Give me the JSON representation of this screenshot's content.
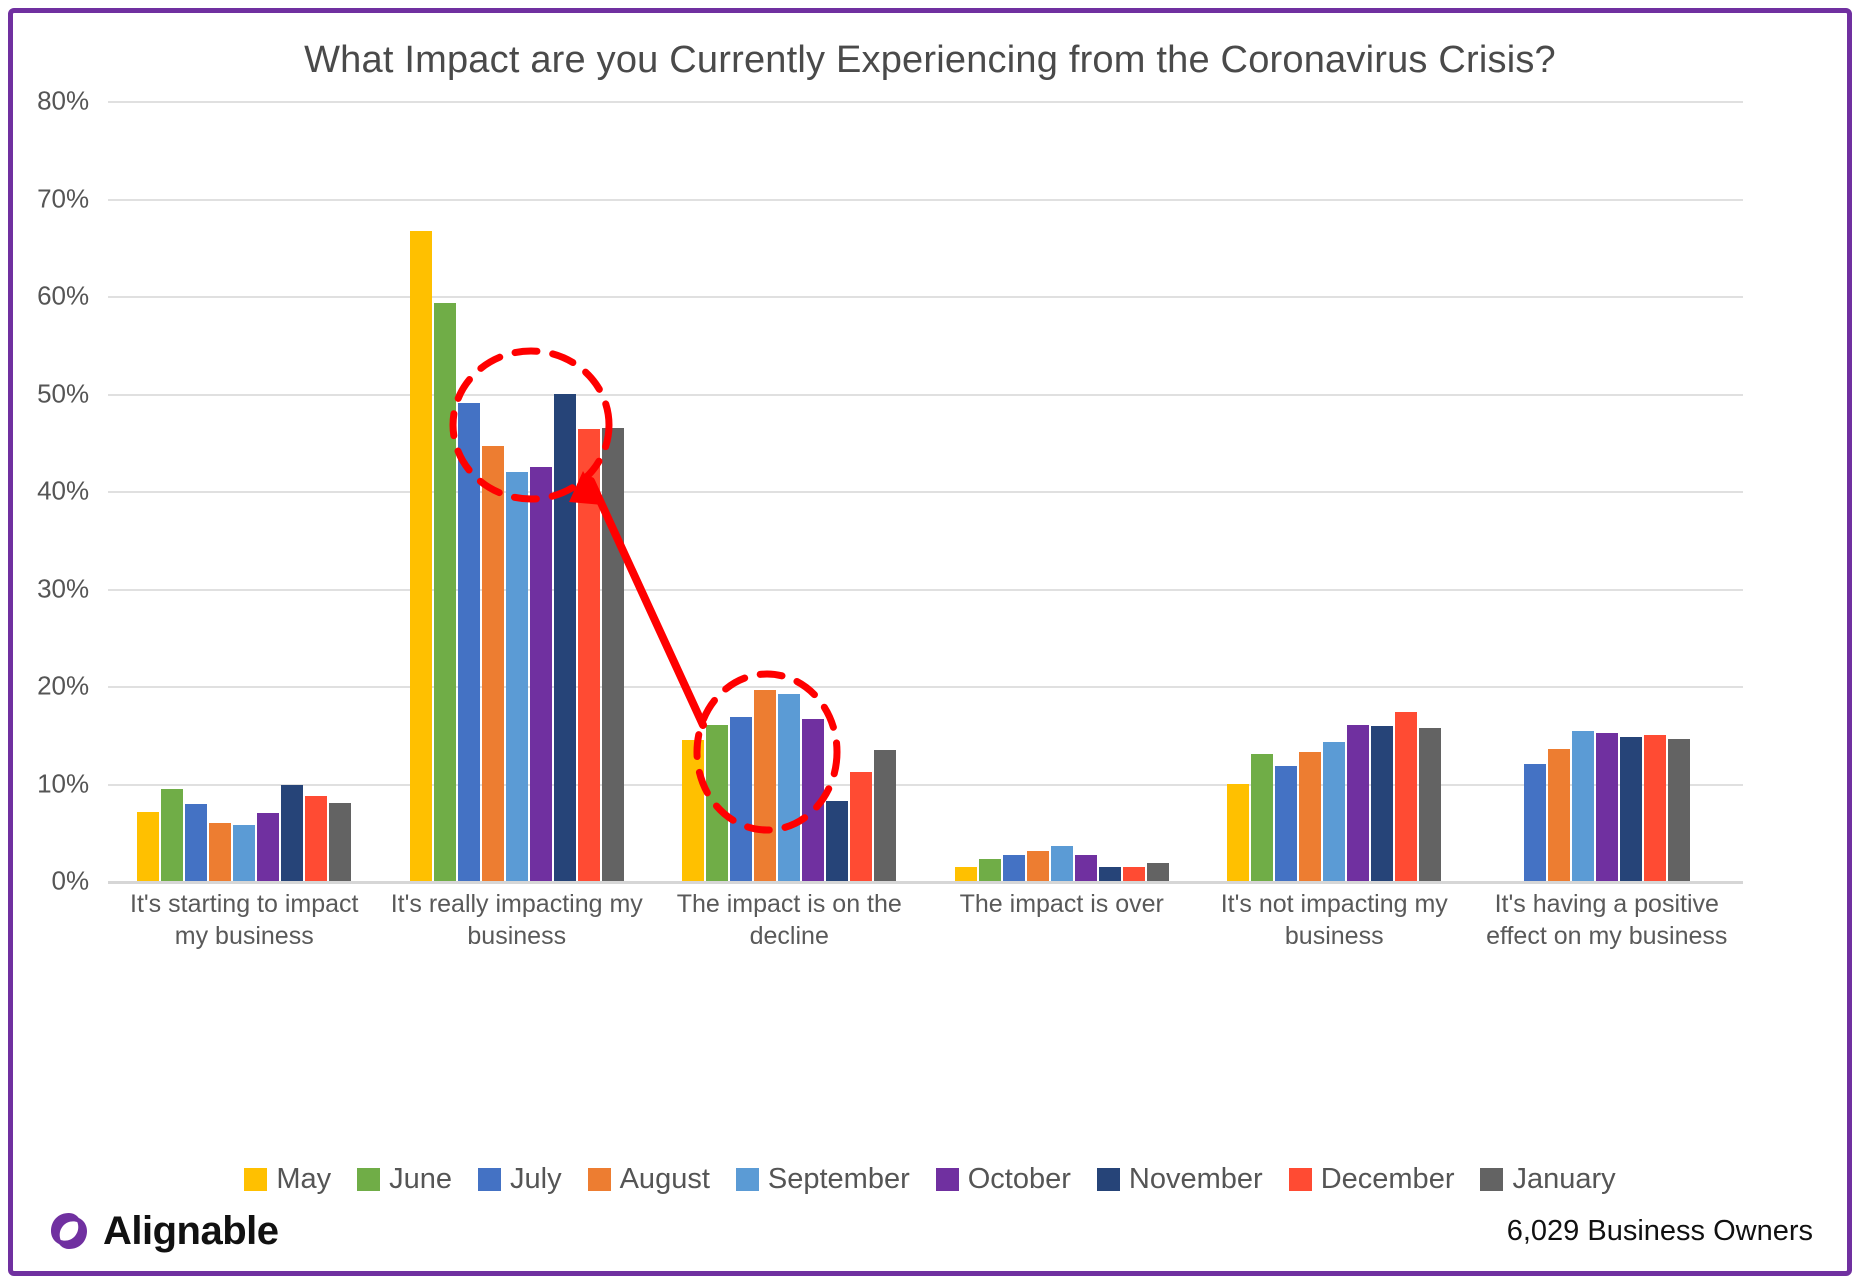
{
  "title": "What Impact are you Currently Experiencing from the Coronavirus Crisis?",
  "footer": {
    "brand": "Alignable",
    "respondents": "6,029 Business Owners"
  },
  "theme": {
    "border": "#7030A0",
    "annotation": "#FF0000",
    "grid": "#E0E0E0",
    "text": "#555555"
  },
  "legend": [
    {
      "label": "May",
      "color": "#FFC000"
    },
    {
      "label": "June",
      "color": "#70AD47"
    },
    {
      "label": "July",
      "color": "#4472C4"
    },
    {
      "label": "August",
      "color": "#ED7D31"
    },
    {
      "label": "September",
      "color": "#5B9BD5"
    },
    {
      "label": "October",
      "color": "#7030A0"
    },
    {
      "label": "November",
      "color": "#264478"
    },
    {
      "label": "December",
      "color": "#FF4B33"
    },
    {
      "label": "January",
      "color": "#636363"
    }
  ],
  "chart_data": {
    "type": "bar",
    "title": "What Impact are you Currently Experiencing from the Coronavirus Crisis?",
    "xlabel": "",
    "ylabel": "",
    "ylim": [
      0,
      80
    ],
    "ytick_labels": [
      "80%",
      "70%",
      "60%",
      "50%",
      "40%",
      "30%",
      "20%",
      "10%",
      "0%"
    ],
    "ytick_values": [
      80,
      70,
      60,
      50,
      40,
      30,
      20,
      10,
      0
    ],
    "grid": true,
    "legend_position": "bottom",
    "units": "percent",
    "categories": [
      "It's starting to impact my business",
      "It's really impacting my business",
      "The impact is on the decline",
      "The impact is over",
      "It's not impacting my business",
      "It's having a positive effect on my business"
    ],
    "series": [
      {
        "name": "May",
        "color": "#FFC000",
        "values": [
          7.1,
          66.7,
          14.5,
          1.4,
          10.0,
          null
        ]
      },
      {
        "name": "June",
        "color": "#70AD47",
        "values": [
          9.4,
          59.3,
          16.0,
          2.3,
          13.0,
          null
        ]
      },
      {
        "name": "July",
        "color": "#4472C4",
        "values": [
          7.9,
          49.0,
          16.8,
          2.7,
          11.8,
          12.0
        ]
      },
      {
        "name": "August",
        "color": "#ED7D31",
        "values": [
          6.0,
          44.6,
          19.6,
          3.1,
          13.2,
          13.5
        ]
      },
      {
        "name": "September",
        "color": "#5B9BD5",
        "values": [
          5.7,
          42.0,
          19.2,
          3.6,
          14.3,
          15.4
        ]
      },
      {
        "name": "October",
        "color": "#7030A0",
        "values": [
          7.0,
          42.5,
          16.6,
          2.7,
          16.0,
          15.2
        ]
      },
      {
        "name": "November",
        "color": "#264478",
        "values": [
          9.8,
          50.0,
          8.2,
          1.4,
          15.9,
          14.8
        ]
      },
      {
        "name": "December",
        "color": "#FF4B33",
        "values": [
          8.7,
          46.4,
          11.2,
          1.4,
          17.3,
          15.0
        ]
      },
      {
        "name": "January",
        "color": "#636363",
        "values": [
          8.0,
          46.5,
          13.4,
          1.8,
          15.7,
          14.6
        ]
      }
    ],
    "annotations": [
      {
        "kind": "ellipse",
        "note": "highlight circle around tall bars in 'It's really impacting my business'",
        "color": "#FF0000",
        "style": "dashed"
      },
      {
        "kind": "ellipse",
        "note": "highlight circle around low bars in 'The impact is on the decline'",
        "color": "#FF0000",
        "style": "dashed"
      },
      {
        "kind": "arrow",
        "note": "arrow pointing from the decline group up to the really-impacting group",
        "color": "#FF0000"
      }
    ]
  }
}
